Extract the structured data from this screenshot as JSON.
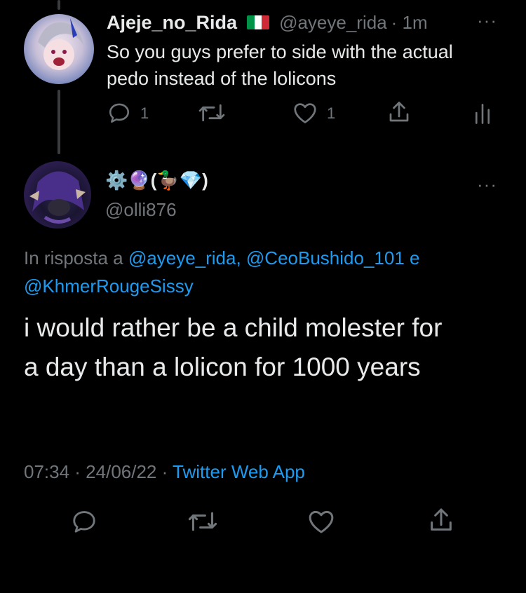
{
  "parent_tweet": {
    "display_name": "Ajeje_no_Rida",
    "flag": "🇮🇹",
    "handle": "@ayeye_rida",
    "time": "· 1m",
    "text_line1": "So you guys prefer to side with the actual",
    "text_line2": "pedo instead of the lolicons",
    "reply_count": "1",
    "like_count": "1",
    "more": "···"
  },
  "main_tweet": {
    "display_name": "⚙️🔮(🦆💎)",
    "handle": "@olli876",
    "more": "···",
    "reply_to_prefix": "In risposta a",
    "reply_to_line1": "@ayeye_rida, @CeoBushido_101 e",
    "reply_to_line2": "@KhmerRougeSissy",
    "text_line1": "i would rather be a child molester for",
    "text_line2": "a day than a lolicon for 1000 years",
    "time": "07:34 · 24/06/22 ·",
    "source": "Twitter Web App"
  },
  "colors": {
    "background": "#000000",
    "text": "#e7e9ea",
    "muted": "#71767b",
    "link": "#1d9bf0"
  }
}
